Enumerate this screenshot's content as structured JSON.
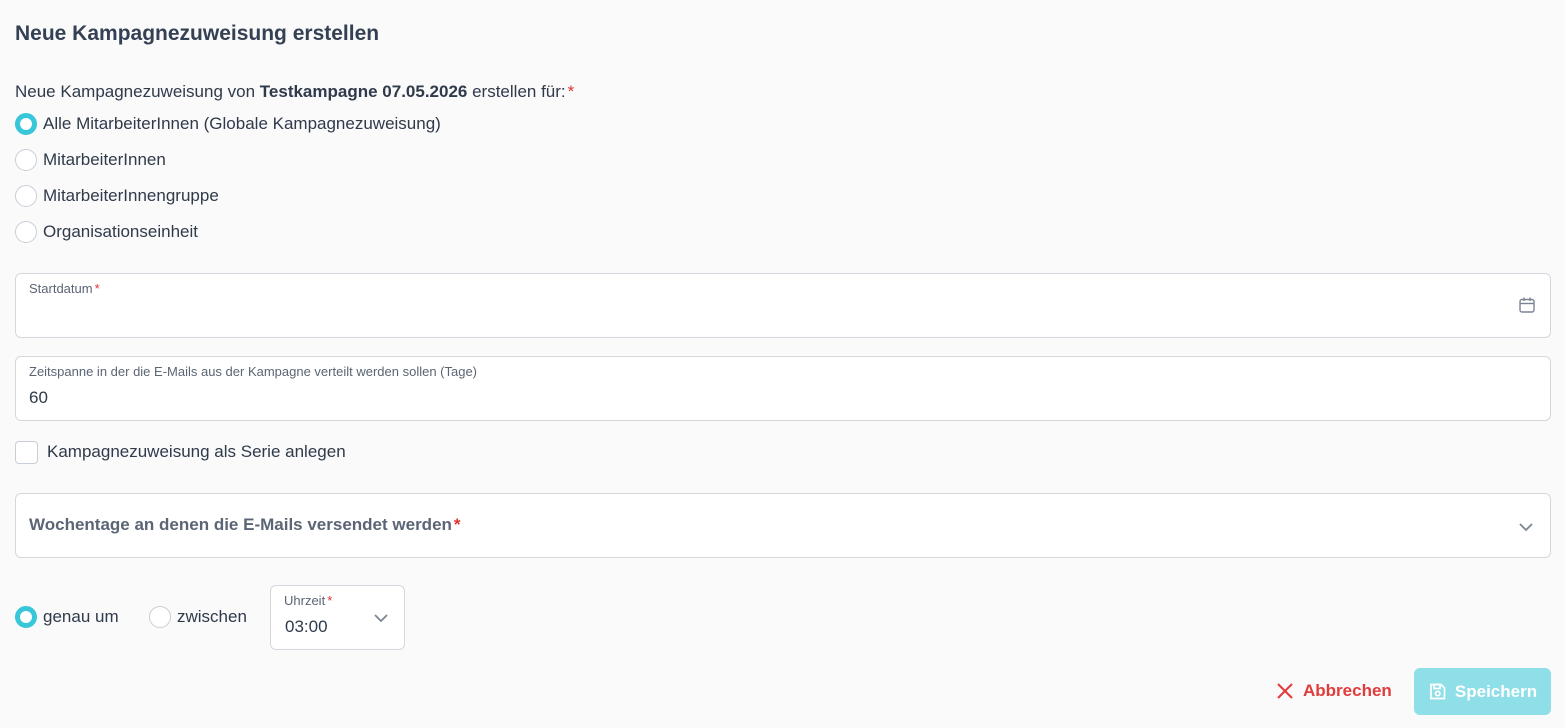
{
  "dialog": {
    "title": "Neue Kampagnezuweisung erstellen",
    "intro_prefix": "Neue Kampagnezuweisung von ",
    "campaign_name": "Testkampagne 07.05.2026",
    "intro_suffix": " erstellen für:",
    "required_mark": "*"
  },
  "target_options": [
    {
      "label": "Alle MitarbeiterInnen (Globale Kampagnezuweisung)",
      "checked": true
    },
    {
      "label": "MitarbeiterInnen",
      "checked": false
    },
    {
      "label": "MitarbeiterInnengruppe",
      "checked": false
    },
    {
      "label": "Organisationseinheit",
      "checked": false
    }
  ],
  "start_date": {
    "label": "Startdatum",
    "value": "",
    "icon": "calendar-icon"
  },
  "duration": {
    "label": "Zeitspanne in der die E-Mails aus der Kampagne verteilt werden sollen (Tage)",
    "value": "60"
  },
  "series_checkbox": {
    "label": "Kampagnezuweisung als Serie anlegen",
    "checked": false
  },
  "weekdays": {
    "label": "Wochentage an denen die E-Mails versendet werden",
    "icon": "chevron-down-icon"
  },
  "time_mode": [
    {
      "label": "genau um",
      "checked": true
    },
    {
      "label": "zwischen",
      "checked": false
    }
  ],
  "time": {
    "label": "Uhrzeit",
    "value": "03:00"
  },
  "actions": {
    "cancel_label": "Abbrechen",
    "save_label": "Speichern",
    "cancel_color": "#e03c3c",
    "save_color": "#8fdfe8",
    "accent": "#38c6d9"
  }
}
